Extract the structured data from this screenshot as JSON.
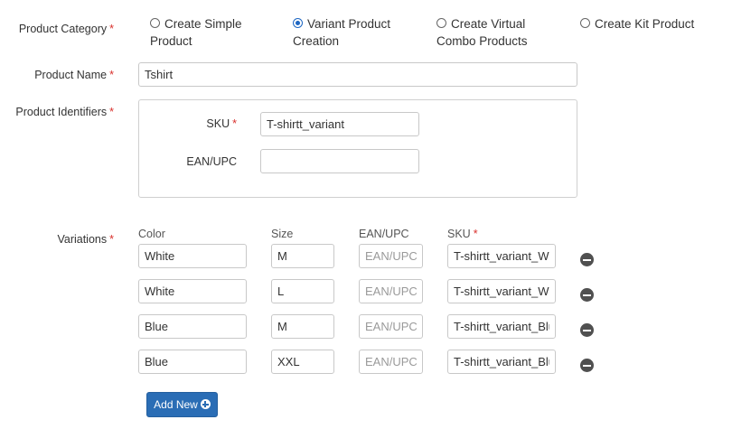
{
  "category": {
    "label": "Product Category",
    "options": [
      {
        "text": "Create Simple Product",
        "selected": false
      },
      {
        "text": "Variant Product Creation",
        "selected": true
      },
      {
        "text": "Create Virtual Combo Products",
        "selected": false
      },
      {
        "text": "Create Kit Product",
        "selected": false
      }
    ]
  },
  "product_name": {
    "label": "Product Name",
    "value": "Tshirt"
  },
  "identifiers": {
    "label": "Product Identifiers",
    "sku_label": "SKU",
    "sku_value": "T-shirtt_variant",
    "ean_label": "EAN/UPC",
    "ean_value": ""
  },
  "variations": {
    "label": "Variations",
    "headers": {
      "color": "Color",
      "size": "Size",
      "ean": "EAN/UPC",
      "sku": "SKU"
    },
    "ean_placeholder": "EAN/UPC",
    "rows": [
      {
        "color": "White",
        "size": "M",
        "ean": "",
        "sku": "T-shirtt_variant_Wh"
      },
      {
        "color": "White",
        "size": "L",
        "ean": "",
        "sku": "T-shirtt_variant_Wh"
      },
      {
        "color": "Blue",
        "size": "M",
        "ean": "",
        "sku": "T-shirtt_variant_Blu"
      },
      {
        "color": "Blue",
        "size": "XXL",
        "ean": "",
        "sku": "T-shirtt_variant_Blu"
      }
    ],
    "add_label": "Add New",
    "required_mark": "*"
  }
}
